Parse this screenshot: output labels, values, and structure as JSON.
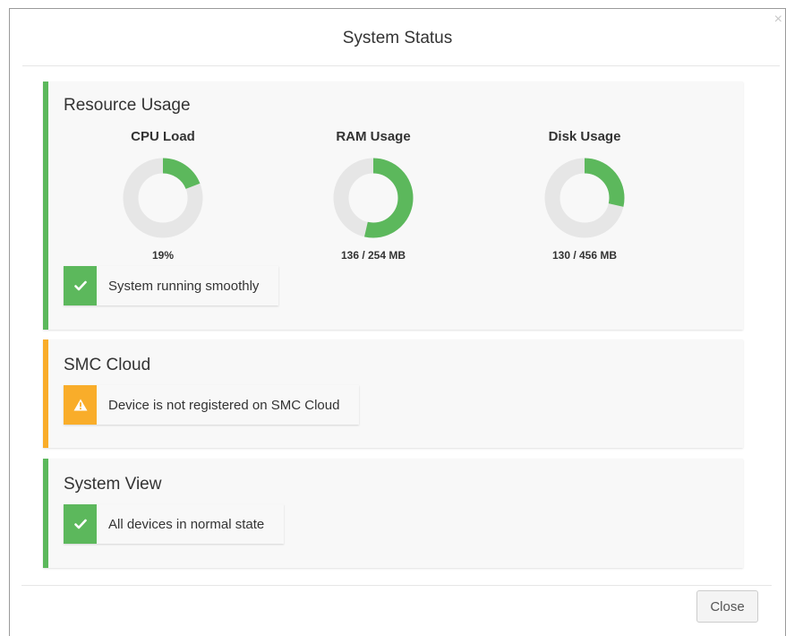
{
  "dialog": {
    "title": "System Status",
    "close_glyph": "×",
    "close_button_label": "Close"
  },
  "colors": {
    "ok": "#5cb85c",
    "warning": "#f9ad2a",
    "track": "#e6e6e6"
  },
  "resource_usage": {
    "title": "Resource Usage",
    "gauges": [
      {
        "label": "CPU Load",
        "value_text": "19%",
        "fraction": 0.19
      },
      {
        "label": "RAM Usage",
        "value_text": "136 / 254 MB",
        "fraction": 0.5354
      },
      {
        "label": "Disk Usage",
        "value_text": "130 / 456 MB",
        "fraction": 0.2851
      }
    ],
    "status": {
      "icon": "check-icon",
      "text": "System running smoothly"
    }
  },
  "smc_cloud": {
    "title": "SMC Cloud",
    "status": {
      "icon": "warning-icon",
      "text": "Device is not registered on SMC Cloud"
    }
  },
  "system_view": {
    "title": "System View",
    "status": {
      "icon": "check-icon",
      "text": "All devices in normal state"
    }
  }
}
